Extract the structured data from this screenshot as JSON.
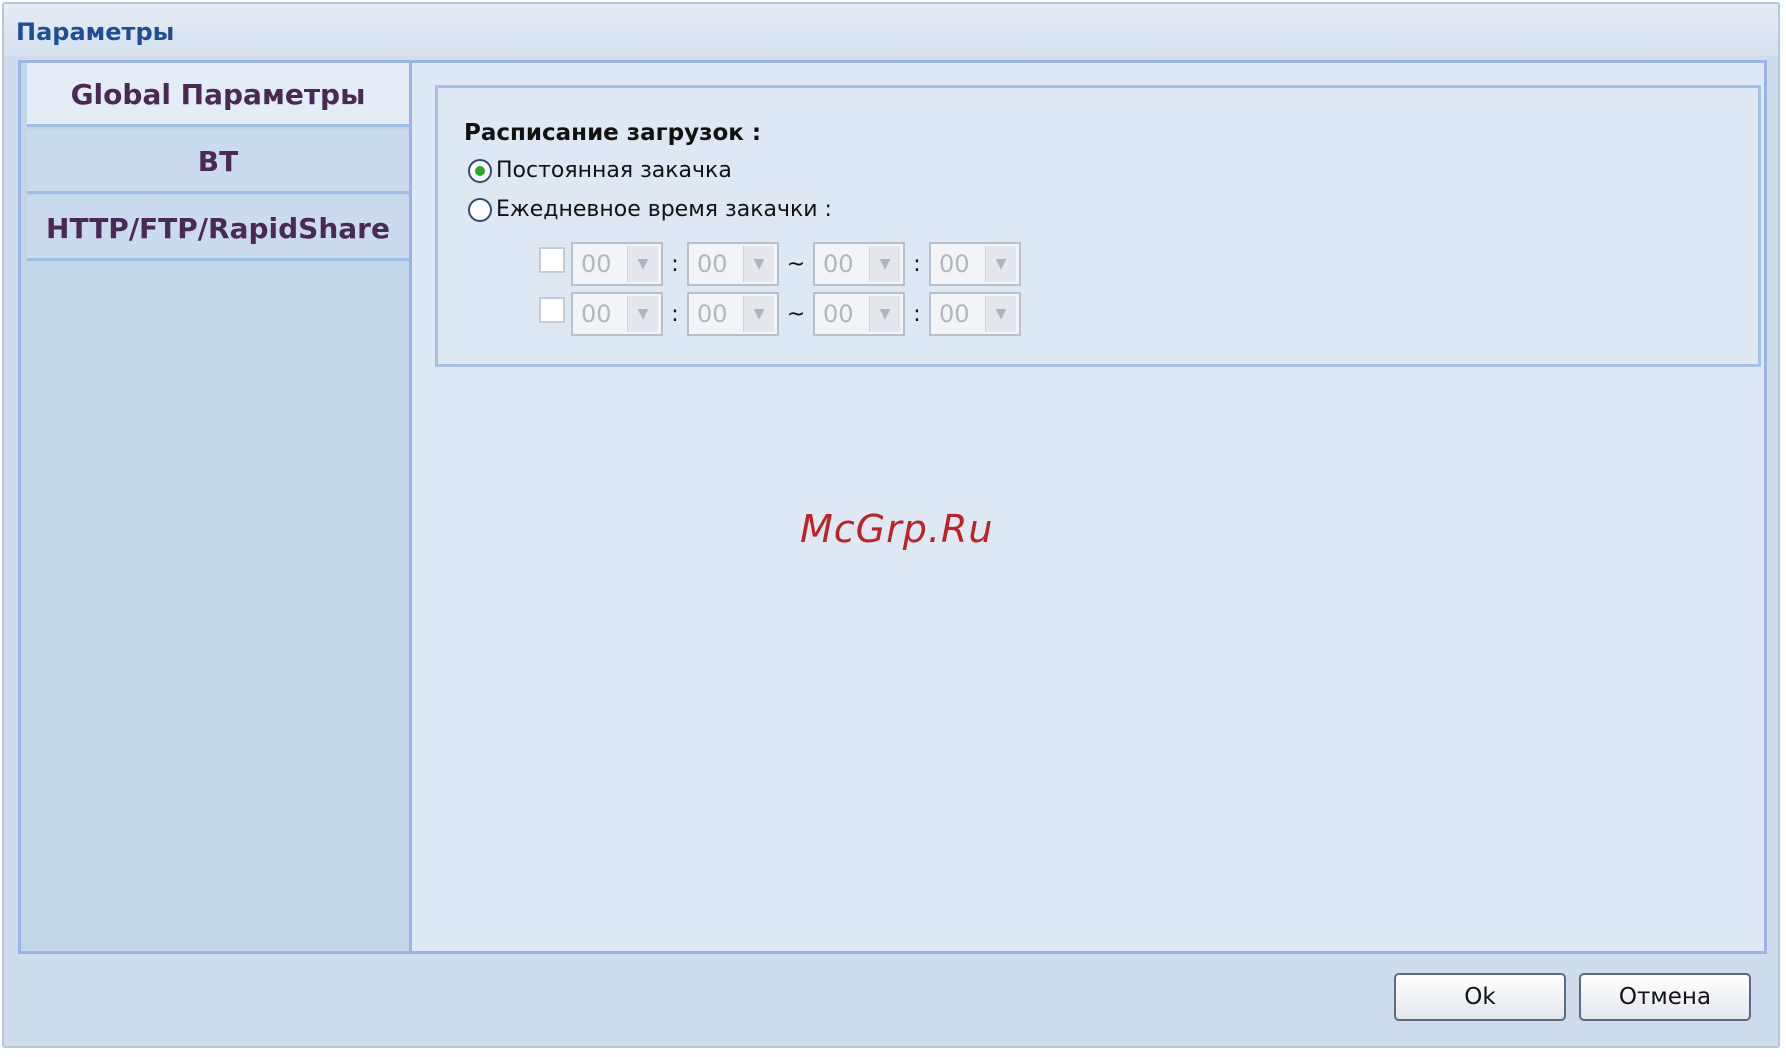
{
  "window": {
    "title": "Параметры"
  },
  "sidebar": {
    "items": [
      {
        "label": "Global Параметры"
      },
      {
        "label": "BT"
      },
      {
        "label": "HTTP/FTP/RapidShare"
      }
    ]
  },
  "schedule": {
    "label": "Расписание загрузок :",
    "options": [
      {
        "label": "Постоянная закачка",
        "selected": true
      },
      {
        "label": "Ежедневное время закачки :",
        "selected": false
      }
    ],
    "rows": [
      {
        "checked": false,
        "start_hour": "00",
        "start_min": "00",
        "end_hour": "00",
        "end_min": "00"
      },
      {
        "checked": false,
        "start_hour": "00",
        "start_min": "00",
        "end_hour": "00",
        "end_min": "00"
      }
    ],
    "time_sep": ":",
    "range_sep": "~"
  },
  "watermark": "McGrp.Ru",
  "buttons": {
    "ok": "Ok",
    "cancel": "Отмена"
  }
}
